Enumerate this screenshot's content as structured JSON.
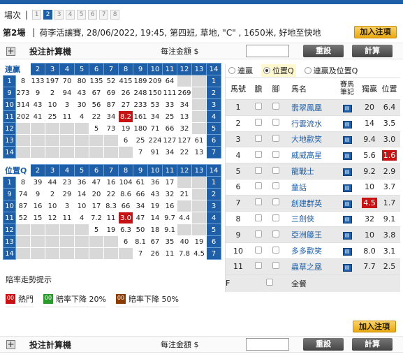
{
  "race_selector": {
    "label": "場次",
    "separator": "|",
    "races": [
      "1",
      "2",
      "3",
      "4",
      "5",
      "6",
      "7",
      "8"
    ],
    "active": "2"
  },
  "race_info": {
    "race_no": "第2場",
    "separator": "|",
    "details": "荷李活讓賽, 28/06/2022, 19:45, 第四班, 草地, \"C\" , 1650米, 好地至快地"
  },
  "add_bet_label": "加入注項",
  "calculator": {
    "title": "投注計算機",
    "amount_label": "每注金額 $",
    "amount_value": "",
    "reset_label": "重設",
    "calc_label": "計算"
  },
  "quinella": {
    "title": "連贏",
    "col_headers": [
      "2",
      "3",
      "4",
      "5",
      "6",
      "7",
      "8",
      "9",
      "10",
      "11",
      "12",
      "13",
      "14"
    ],
    "rows": [
      {
        "label": "1",
        "cells": [
          "8",
          "133",
          "197",
          "70",
          "80",
          "135",
          "52",
          "415",
          "189",
          "209",
          "64",
          "",
          ""
        ]
      },
      {
        "label": "9",
        "cells": [
          "273",
          "9",
          "2",
          "94",
          "43",
          "67",
          "69",
          "26",
          "248",
          "150",
          "111",
          "269",
          ""
        ]
      },
      {
        "label": "10",
        "cells": [
          "314",
          "43",
          "10",
          "3",
          "30",
          "56",
          "87",
          "27",
          "233",
          "53",
          "33",
          "34",
          ""
        ]
      },
      {
        "label": "11",
        "cells": [
          "202",
          "41",
          "25",
          "11",
          "4",
          "22",
          "34",
          "8.2",
          "161",
          "34",
          "25",
          "13",
          ""
        ]
      },
      {
        "label": "12",
        "cells": [
          "",
          "",
          "",
          "",
          "",
          "5",
          "73",
          "19",
          "180",
          "71",
          "66",
          "32",
          ""
        ]
      },
      {
        "label": "13",
        "cells": [
          "",
          "",
          "",
          "",
          "",
          "",
          "",
          "6",
          "25",
          "224",
          "127",
          "127",
          "61"
        ]
      },
      {
        "label": "14",
        "cells": [
          "",
          "",
          "",
          "",
          "",
          "",
          "",
          "",
          "7",
          "91",
          "34",
          "22",
          "13"
        ]
      }
    ],
    "right_labels": [
      "1",
      "2",
      "3",
      "4",
      "5",
      "6",
      "7"
    ],
    "bottom_labels": [
      "8",
      "9",
      "10",
      "11",
      "12",
      "13",
      "14"
    ]
  },
  "place_q": {
    "title": "位置Q",
    "col_headers": [
      "2",
      "3",
      "4",
      "5",
      "6",
      "7",
      "8",
      "9",
      "10",
      "11",
      "12",
      "13",
      "14"
    ],
    "rows": [
      {
        "label": "1",
        "cells": [
          "8",
          "39",
          "44",
          "23",
          "36",
          "47",
          "16",
          "104",
          "61",
          "36",
          "17",
          "",
          ""
        ]
      },
      {
        "label": "9",
        "cells": [
          "74",
          "9",
          "2",
          "29",
          "14",
          "20",
          "22",
          "8.6",
          "66",
          "43",
          "32",
          "21",
          ""
        ]
      },
      {
        "label": "10",
        "cells": [
          "87",
          "16",
          "10",
          "3",
          "10",
          "17",
          "8.3",
          "66",
          "34",
          "19",
          "16",
          "",
          ""
        ]
      },
      {
        "label": "11",
        "cells": [
          "52",
          "15",
          "12",
          "11",
          "4",
          "7.2",
          "11",
          "3.0",
          "47",
          "14",
          "9.7",
          "4.4",
          ""
        ]
      },
      {
        "label": "12",
        "cells": [
          "",
          "",
          "",
          "",
          "",
          "5",
          "19",
          "6.3",
          "50",
          "18",
          "9.1",
          "",
          ""
        ]
      },
      {
        "label": "13",
        "cells": [
          "",
          "",
          "",
          "",
          "",
          "",
          "",
          "6",
          "8.1",
          "67",
          "35",
          "40",
          "19"
        ]
      },
      {
        "label": "14",
        "cells": [
          "",
          "",
          "",
          "",
          "",
          "",
          "",
          "",
          "7",
          "26",
          "11",
          "7.8",
          "4.5"
        ]
      }
    ],
    "right_labels": [
      "1",
      "2",
      "3",
      "4",
      "5",
      "6",
      "7"
    ],
    "bottom_labels": [
      "8",
      "9",
      "10",
      "11",
      "12",
      "13",
      "14"
    ]
  },
  "trend_legend": {
    "title": "賠率走勢提示",
    "items": [
      {
        "badge": "00",
        "label": "熱門",
        "color": "#c61212"
      },
      {
        "badge": "00",
        "label": "賠率下降 20%",
        "color": "#2a9a2a"
      },
      {
        "badge": "00",
        "label": "賠率下降 50%",
        "color": "#8a3b00"
      }
    ]
  },
  "bet_types": {
    "options": [
      "連贏",
      "位置Q",
      "連贏及位置Q"
    ],
    "selected": "位置Q"
  },
  "horse_table": {
    "headers": {
      "no": "馬號",
      "banker": "膽",
      "leg": "腳",
      "name": "馬名",
      "form": "賽馬筆記",
      "win": "獨贏",
      "place": "位置"
    },
    "horses": [
      {
        "no": "1",
        "name": "翡翠鳳凰",
        "win": "20",
        "place": "6.4",
        "hot_win": false,
        "hot_place": false
      },
      {
        "no": "2",
        "name": "行雲流水",
        "win": "14",
        "place": "3.5",
        "hot_win": false,
        "hot_place": false
      },
      {
        "no": "3",
        "name": "大地歡笑",
        "win": "9.4",
        "place": "3.0",
        "hot_win": false,
        "hot_place": false
      },
      {
        "no": "4",
        "name": "威威高星",
        "win": "5.6",
        "place": "1.6",
        "hot_win": false,
        "hot_place": true
      },
      {
        "no": "5",
        "name": "龍戰士",
        "win": "9.2",
        "place": "2.9",
        "hot_win": false,
        "hot_place": false
      },
      {
        "no": "6",
        "name": "童話",
        "win": "10",
        "place": "3.7",
        "hot_win": false,
        "hot_place": false
      },
      {
        "no": "7",
        "name": "創建群英",
        "win": "4.5",
        "place": "1.7",
        "hot_win": true,
        "hot_place": false
      },
      {
        "no": "8",
        "name": "三劍俠",
        "win": "32",
        "place": "9.1",
        "hot_win": false,
        "hot_place": false
      },
      {
        "no": "9",
        "name": "亞洲籐王",
        "win": "10",
        "place": "3.8",
        "hot_win": false,
        "hot_place": false
      },
      {
        "no": "10",
        "name": "多多歡笑",
        "win": "8.0",
        "place": "3.1",
        "hot_win": false,
        "hot_place": false
      },
      {
        "no": "11",
        "name": "蟲草之凰",
        "win": "7.7",
        "place": "2.5",
        "hot_win": false,
        "hot_place": false
      }
    ],
    "field_row": {
      "label": "F",
      "text": "全餐"
    }
  },
  "colors": {
    "brand": "#1e5fa8",
    "hot": "#c61212"
  }
}
